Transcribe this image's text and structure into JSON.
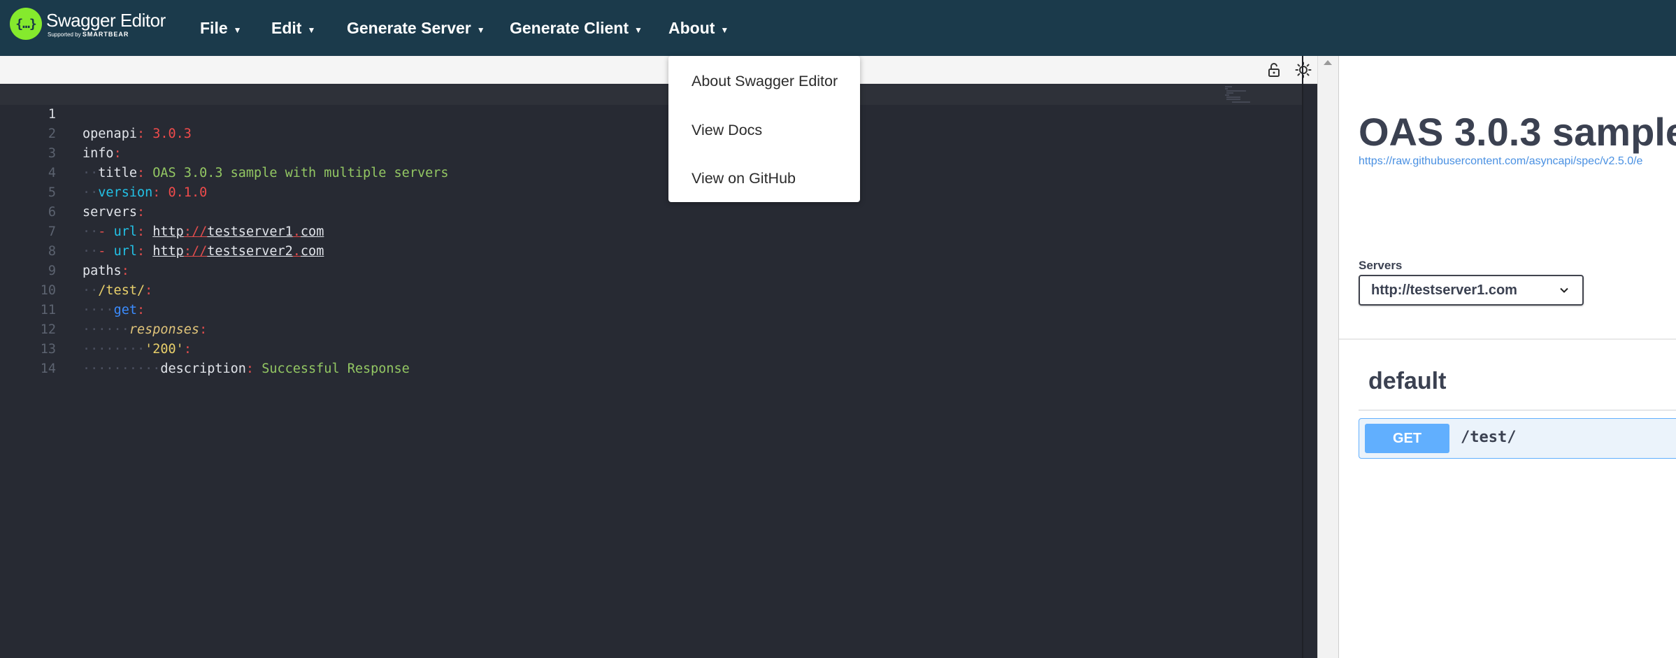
{
  "app": {
    "logo_title": "Swagger Editor",
    "logo_subtitle_prefix": "Supported by",
    "logo_subtitle_brand": "SMARTBEAR"
  },
  "menu": {
    "items": [
      {
        "label": "File"
      },
      {
        "label": "Edit"
      },
      {
        "label": "Generate Server"
      },
      {
        "label": "Generate Client"
      },
      {
        "label": "About"
      }
    ],
    "caret": "▼"
  },
  "about_dropdown": {
    "items": [
      {
        "label": "About Swagger Editor"
      },
      {
        "label": "View Docs"
      },
      {
        "label": "View on GitHub"
      }
    ]
  },
  "editor": {
    "line_numbers": [
      "1",
      "2",
      "3",
      "4",
      "5",
      "6",
      "7",
      "8",
      "9",
      "10",
      "11",
      "12",
      "13",
      "14"
    ],
    "current_line": 1,
    "tokens": {
      "l1_key": "openapi",
      "l1_val": "3.0.3",
      "l2_key": "info",
      "l3_key": "title",
      "l3_val": "OAS 3.0.3 sample with multiple servers",
      "l4_key": "version",
      "l4_val": "0.1.0",
      "l5_key": "servers",
      "l6_key": "url",
      "l6_scheme": "http",
      "l6_sep": "://",
      "l6_host1": "testserver1",
      "l6_dot": ".",
      "l6_host2": "com",
      "l7_key": "url",
      "l7_scheme": "http",
      "l7_sep": "://",
      "l7_host1": "testserver2",
      "l7_dot": ".",
      "l7_host2": "com",
      "l8_key": "paths",
      "l9_key": "/test/",
      "l10_key": "get",
      "l11_key": "responses",
      "l12_key": "'200'",
      "l13_key": "description",
      "l13_val": "Successful Response"
    }
  },
  "preview": {
    "title": "OAS 3.0.3 sample",
    "spec_url": "https://raw.githubusercontent.com/asyncapi/spec/v2.5.0/e",
    "servers_label": "Servers",
    "selected_server": "http://testserver1.com",
    "tag": "default",
    "operation": {
      "method": "GET",
      "path": "/test/"
    }
  },
  "colors": {
    "topbar": "#1b3a4b",
    "logo_green": "#85ea2d",
    "editor_bg": "#272a33",
    "get_blue": "#61affe"
  },
  "icons": {
    "toolbar": [
      "unlock-icon",
      "sun-icon"
    ],
    "server_select": "chevron-down-icon"
  }
}
